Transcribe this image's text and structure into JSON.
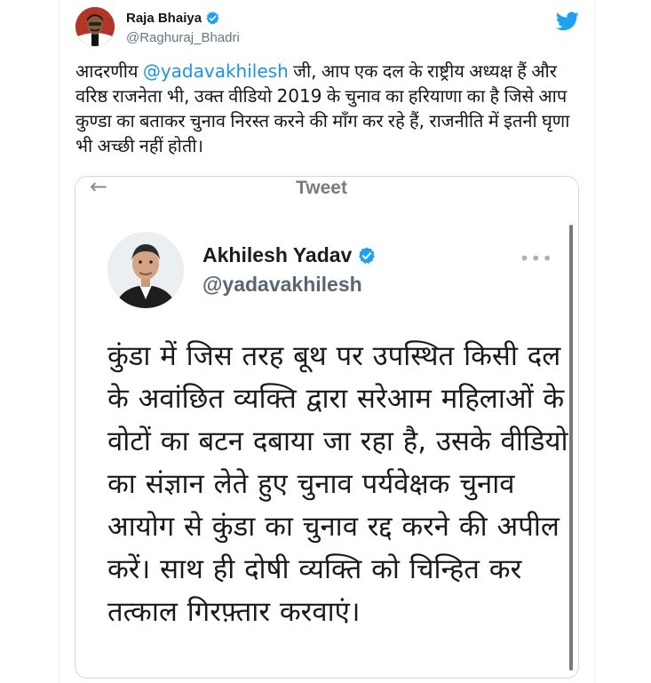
{
  "tweet": {
    "author_name": "Raja Bhaiya",
    "author_handle": "@Raghuraj_Bhadri",
    "text_before_mention": "आदरणीय ",
    "mention": "@yadavakhilesh",
    "text_after_mention": " जी, आप एक दल के राष्ट्रीय अध्यक्ष हैं और वरिष्ठ राजनेता भी, उक्त वीडियो 2019 के चुनाव का हरियाणा का है जिसे आप कुण्डा का बताकर चुनाव निरस्त करने की माँग कर रहे हैं, राजनीति में इतनी घृणा भी अच्छी नहीं होती।",
    "bird_icon": "twitter-bird-icon",
    "verified_icon": "verified-badge-icon",
    "colors": {
      "accent": "#1da1f2",
      "mention": "#1b95e0",
      "secondary": "#657786"
    }
  },
  "embed": {
    "header_title": "Tweet",
    "back_icon": "back-arrow-icon",
    "more_icon": "more-options-icon",
    "author_name": "Akhilesh Yadav",
    "author_handle": "@yadavakhilesh",
    "text": "कुंडा में जिस तरह बूथ पर उपस्थित किसी दल के अवांछित व्यक्ति द्वारा सरेआम महिलाओं के वोटों का बटन दबाया जा रहा है, उसके वीडियो का संज्ञान लेते हुए चुनाव पर्यवेक्षक चुनाव आयोग से कुंडा का चुनाव रद्द करने की अपील करें। साथ ही दोषी व्यक्ति को चिन्हित कर तत्काल गिरफ़्तार करवाएं।"
  }
}
